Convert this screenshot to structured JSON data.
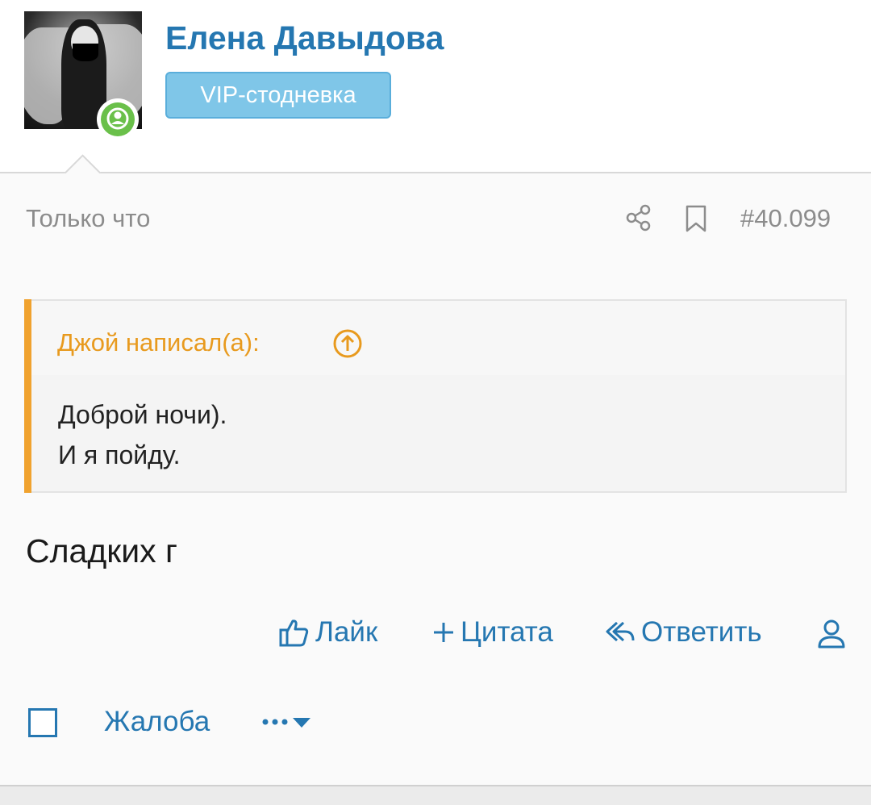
{
  "user": {
    "name": "Елена Давыдова",
    "title_badge": "VIP-стодневка",
    "status": "online"
  },
  "post": {
    "time": "Только что",
    "number": "#40.099",
    "quote": {
      "author": "Джой написал(а):",
      "lines": [
        "Доброй ночи).",
        "И я пойду."
      ]
    },
    "text": "Сладких г"
  },
  "actions": {
    "like": "Лайк",
    "quote": "Цитата",
    "reply": "Ответить"
  },
  "footer": {
    "report": "Жалоба"
  },
  "colors": {
    "link": "#2577b1",
    "badge": "#7fc6e8",
    "quote_accent": "#f0a22e",
    "online": "#6ac04a"
  },
  "icons": [
    "share-icon",
    "bookmark-icon",
    "arrow-up-circle-icon",
    "thumbs-up-icon",
    "plus-icon",
    "reply-icon",
    "user-icon",
    "more-icon",
    "caret-down-icon"
  ]
}
